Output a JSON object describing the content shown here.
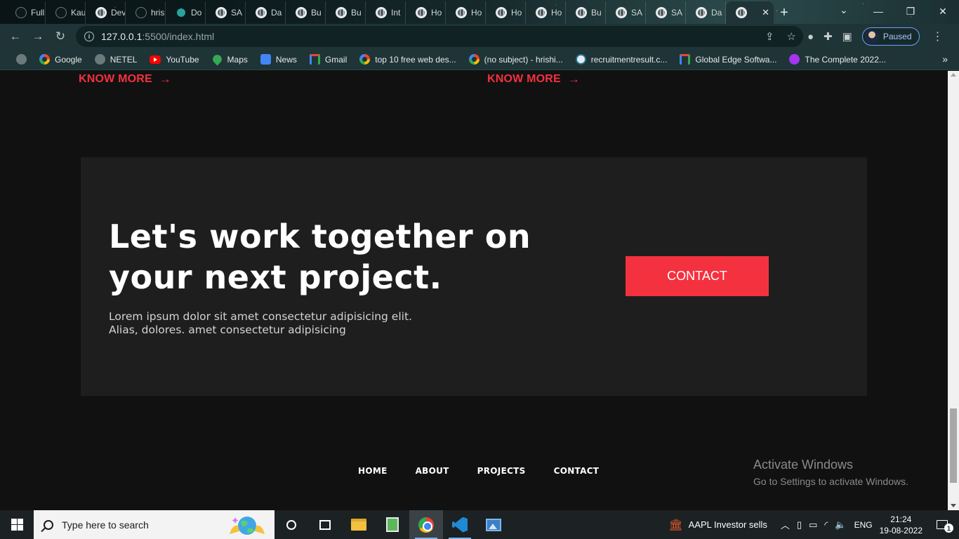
{
  "browser": {
    "tabs": [
      {
        "label": "Full",
        "icon": "github-icon"
      },
      {
        "label": "Kau",
        "icon": "github-icon"
      },
      {
        "label": "Dev",
        "icon": "world-icon"
      },
      {
        "label": "hris",
        "icon": "github-icon"
      },
      {
        "label": "Do",
        "icon": "diamond-icon"
      },
      {
        "label": "SA",
        "icon": "world-icon"
      },
      {
        "label": "Da",
        "icon": "world-icon"
      },
      {
        "label": "Bu",
        "icon": "world-icon"
      },
      {
        "label": "Bu",
        "icon": "world-icon"
      },
      {
        "label": "Int",
        "icon": "world-icon"
      },
      {
        "label": "Ho",
        "icon": "world-icon"
      },
      {
        "label": "Ho",
        "icon": "world-icon"
      },
      {
        "label": "Ho",
        "icon": "world-icon"
      },
      {
        "label": "Ho",
        "icon": "world-icon"
      },
      {
        "label": "Bu",
        "icon": "world-icon"
      },
      {
        "label": "SA",
        "icon": "world-icon"
      },
      {
        "label": "SA",
        "icon": "world-icon"
      },
      {
        "label": "Da",
        "icon": "world-icon"
      }
    ],
    "new_tab": "+",
    "url": {
      "host": "127.0.0.1",
      "rest": ":5500/index.html"
    },
    "profile_status": "Paused",
    "bookmarks": [
      {
        "label": "",
        "icon": "world-icon"
      },
      {
        "label": "Google",
        "icon": "google-icon"
      },
      {
        "label": "NETEL",
        "icon": "world-icon"
      },
      {
        "label": "YouTube",
        "icon": "youtube-icon"
      },
      {
        "label": "Maps",
        "icon": "maps-icon"
      },
      {
        "label": "News",
        "icon": "news-icon"
      },
      {
        "label": "Gmail",
        "icon": "gmail-icon"
      },
      {
        "label": "top 10 free web des...",
        "icon": "google-icon"
      },
      {
        "label": "(no subject) - hrishi...",
        "icon": "google-icon"
      },
      {
        "label": "recruitmentresult.c...",
        "icon": "wordpress-icon"
      },
      {
        "label": "Global Edge Softwa...",
        "icon": "gmail-icon"
      },
      {
        "label": "The Complete 2022...",
        "icon": "udemy-icon"
      }
    ],
    "bookmarks_more": "»"
  },
  "page": {
    "know_more": [
      "KNOW MORE",
      "KNOW MORE"
    ],
    "know_more_arrow": "→",
    "cta": {
      "title": "Let's work together on your next project.",
      "description": "Lorem ipsum dolor sit amet consectetur adipisicing elit. Alias, dolores. amet consectetur adipisicing",
      "button": "CONTACT"
    },
    "footer_nav": [
      "HOME",
      "ABOUT",
      "PROJECTS",
      "CONTACT"
    ],
    "watermark": {
      "title": "Activate Windows",
      "subtitle": "Go to Settings to activate Windows."
    }
  },
  "taskbar": {
    "search_placeholder": "Type here to search",
    "stock_text": "AAPL  Investor sells",
    "language": "ENG",
    "time": "21:24",
    "date": "19-08-2022",
    "notification_count": "1"
  },
  "colors": {
    "accent": "#f4313f",
    "page_bg": "#111111",
    "cta_bg": "#1e1e1e",
    "browser_frame": "#1f3436"
  }
}
